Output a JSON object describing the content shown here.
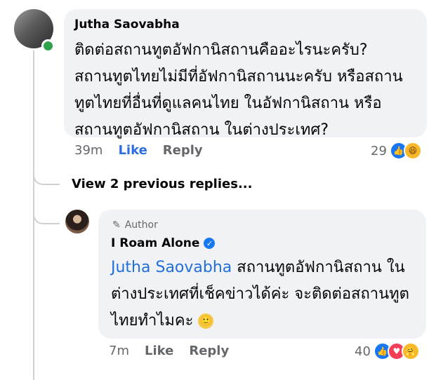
{
  "comment": {
    "author": "Jutha Saovabha",
    "lines": [
      "ติดต่อสถานทูตอัฟกานิสถานคืออะไรนะครับ?",
      "สถานทูตไทยไม่มีที่อัฟกานิสถานนะครับ หรือสถาน",
      "ทูตไทยที่อื่นที่ดูแลคนไทย ในอัฟกานิสถาน หรือ",
      "สถานทูตอัฟกานิสถาน ในต่างประเทศ?"
    ],
    "time": "39m",
    "like_label": "Like",
    "reply_label": "Reply",
    "reaction_count": "29",
    "reaction_icons": [
      "like-icon",
      "haha-icon"
    ]
  },
  "view_replies_label": "View 2 previous replies...",
  "reply": {
    "badge": "Author",
    "author": "I Roam Alone",
    "mention": "Jutha Saovabha",
    "lines": [
      " สถานทูตอัฟกานิสถาน ใน",
      "ต่างประเทศที่เช็คข่าวได้ค่ะ จะติดต่อสถานทูต",
      "ไทยทำไมคะ "
    ],
    "emoji": "🙂",
    "time": "7m",
    "like_label": "Like",
    "reply_label": "Reply",
    "reaction_count": "40",
    "reaction_icons": [
      "like-icon",
      "love-icon",
      "care-icon"
    ]
  },
  "colors": {
    "bubble": "#f0f2f5",
    "mention": "#216fdb",
    "like_active": "#2d6de0",
    "online": "#31a24c"
  }
}
